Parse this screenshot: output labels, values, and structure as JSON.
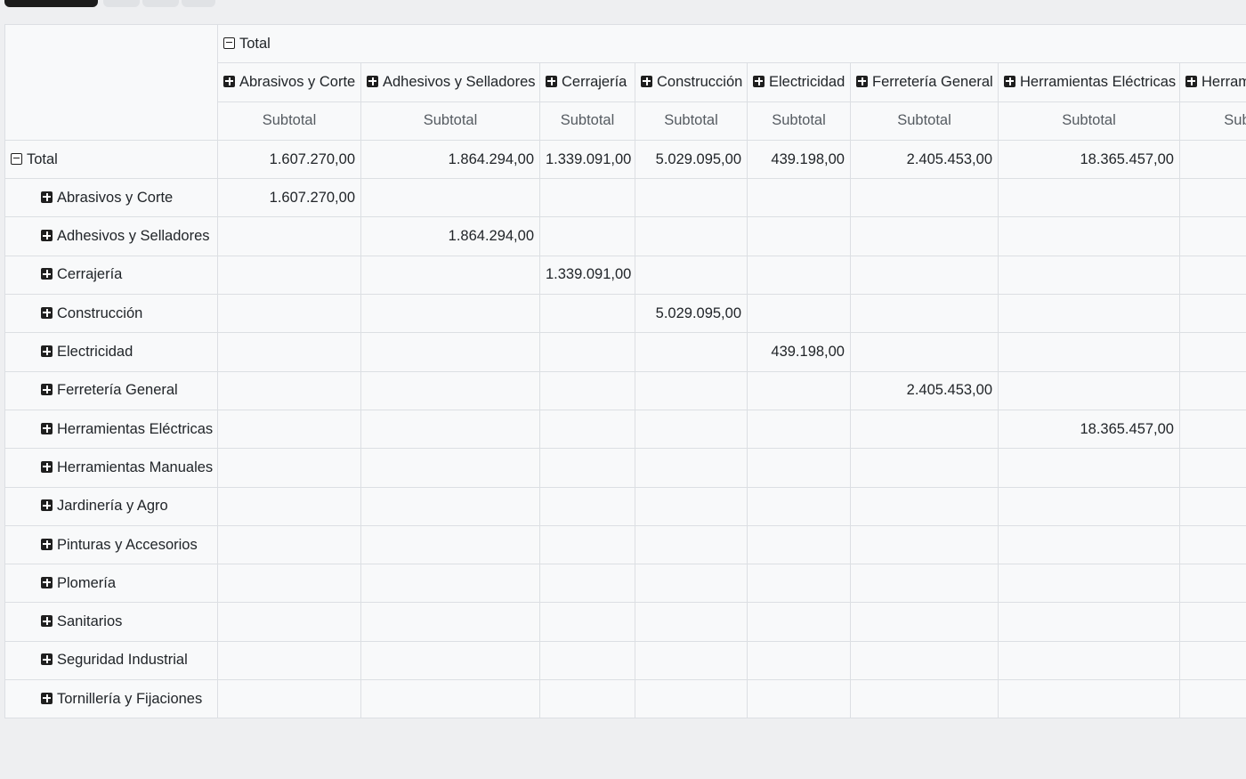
{
  "pivot": {
    "col_total_label": "Total",
    "row_total_label": "Total",
    "subtotal_label": "Subtotal",
    "columns": [
      "Abrasivos y Corte",
      "Adhesivos y Selladores",
      "Cerrajería",
      "Construcción",
      "Electricidad",
      "Ferretería General",
      "Herramientas Eléctricas",
      "Herramientas Manuales"
    ],
    "total_row": [
      "1.607.270,00",
      "1.864.294,00",
      "1.339.091,00",
      "5.029.095,00",
      "439.198,00",
      "2.405.453,00",
      "18.365.457,00",
      ""
    ],
    "rows": [
      {
        "label": "Abrasivos y Corte",
        "values": [
          "1.607.270,00",
          "",
          "",
          "",
          "",
          "",
          "",
          ""
        ]
      },
      {
        "label": "Adhesivos y Selladores",
        "values": [
          "",
          "1.864.294,00",
          "",
          "",
          "",
          "",
          "",
          ""
        ]
      },
      {
        "label": "Cerrajería",
        "values": [
          "",
          "",
          "1.339.091,00",
          "",
          "",
          "",
          "",
          ""
        ]
      },
      {
        "label": "Construcción",
        "values": [
          "",
          "",
          "",
          "5.029.095,00",
          "",
          "",
          "",
          ""
        ]
      },
      {
        "label": "Electricidad",
        "values": [
          "",
          "",
          "",
          "",
          "439.198,00",
          "",
          "",
          ""
        ]
      },
      {
        "label": "Ferretería General",
        "values": [
          "",
          "",
          "",
          "",
          "",
          "2.405.453,00",
          "",
          ""
        ]
      },
      {
        "label": "Herramientas Eléctricas",
        "values": [
          "",
          "",
          "",
          "",
          "",
          "",
          "18.365.457,00",
          ""
        ]
      },
      {
        "label": "Herramientas Manuales",
        "values": [
          "",
          "",
          "",
          "",
          "",
          "",
          "",
          ""
        ]
      },
      {
        "label": "Jardinería y Agro",
        "values": [
          "",
          "",
          "",
          "",
          "",
          "",
          "",
          ""
        ]
      },
      {
        "label": "Pinturas y Accesorios",
        "values": [
          "",
          "",
          "",
          "",
          "",
          "",
          "",
          ""
        ]
      },
      {
        "label": "Plomería",
        "values": [
          "",
          "",
          "",
          "",
          "",
          "",
          "",
          ""
        ]
      },
      {
        "label": "Sanitarios",
        "values": [
          "",
          "",
          "",
          "",
          "",
          "",
          "",
          ""
        ]
      },
      {
        "label": "Seguridad Industrial",
        "values": [
          "",
          "",
          "",
          "",
          "",
          "",
          "",
          ""
        ]
      },
      {
        "label": "Tornillería y Fijaciones",
        "values": [
          "",
          "",
          "",
          "",
          "",
          "",
          "",
          ""
        ]
      }
    ]
  },
  "icons": {
    "expand": "plus-square-icon",
    "collapse": "minus-square-icon"
  }
}
